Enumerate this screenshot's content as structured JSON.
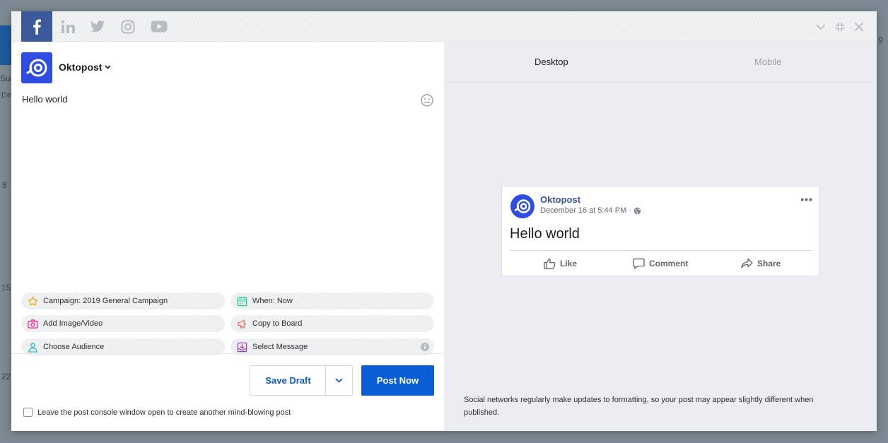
{
  "background": {
    "nums": [
      "Sun",
      "De",
      "8",
      "15",
      "22",
      "9"
    ]
  },
  "networks": [
    {
      "name": "facebook",
      "active": true
    },
    {
      "name": "linkedin",
      "active": false
    },
    {
      "name": "twitter",
      "active": false
    },
    {
      "name": "instagram",
      "active": false
    },
    {
      "name": "youtube",
      "active": false
    }
  ],
  "account": {
    "name": "Oktopost"
  },
  "composer": {
    "text": "Hello world"
  },
  "actions": {
    "campaign": "Campaign: 2019 General Campaign",
    "when": "When: Now",
    "add_media": "Add Image/Video",
    "copy_board": "Copy to Board",
    "audience": "Choose Audience",
    "select_message": "Select Message"
  },
  "buttons": {
    "save_draft": "Save Draft",
    "post_now": "Post Now"
  },
  "keep_open_label": "Leave the post console window open to create another mind-blowing post",
  "preview": {
    "tabs": {
      "desktop": "Desktop",
      "mobile": "Mobile"
    },
    "card": {
      "name": "Oktopost",
      "time": "December 16 at 5:44 PM ·",
      "text": "Hello world",
      "like": "Like",
      "comment": "Comment",
      "share": "Share"
    },
    "disclaimer": "Social networks regularly make updates to formatting, so your post may appear slightly different when published."
  },
  "colors": {
    "facebook": "#3b5998",
    "primary": "#0b5dd6",
    "brand": "#2f4de0"
  }
}
